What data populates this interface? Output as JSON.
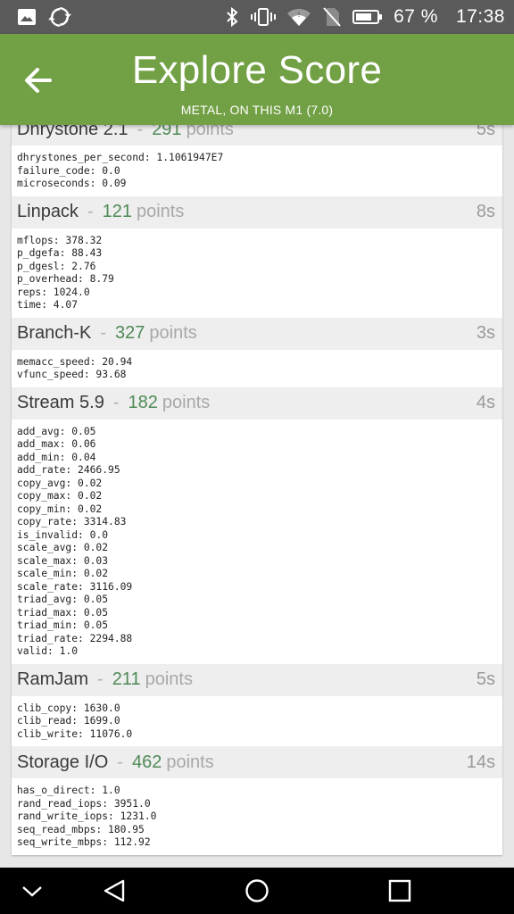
{
  "status_bar": {
    "battery": "67 %",
    "time": "17:38"
  },
  "app_bar": {
    "title": "Explore Score",
    "subtitle": "METAL, ON THIS M1 (7.0)"
  },
  "sections": [
    {
      "name": "Dhrystone 2.1",
      "score": "291",
      "points_label": "points",
      "time": "5s",
      "lines": [
        "dhrystones_per_second: 1.1061947E7",
        "failure_code: 0.0",
        "microseconds: 0.09"
      ]
    },
    {
      "name": "Linpack",
      "score": "121",
      "points_label": "points",
      "time": "8s",
      "lines": [
        "mflops: 378.32",
        "p_dgefa: 88.43",
        "p_dgesl: 2.76",
        "p_overhead: 8.79",
        "reps: 1024.0",
        "time: 4.07"
      ]
    },
    {
      "name": "Branch-K",
      "score": "327",
      "points_label": "points",
      "time": "3s",
      "lines": [
        "memacc_speed: 20.94",
        "vfunc_speed: 93.68"
      ]
    },
    {
      "name": "Stream 5.9",
      "score": "182",
      "points_label": "points",
      "time": "4s",
      "lines": [
        "add_avg: 0.05",
        "add_max: 0.06",
        "add_min: 0.04",
        "add_rate: 2466.95",
        "copy_avg: 0.02",
        "copy_max: 0.02",
        "copy_min: 0.02",
        "copy_rate: 3314.83",
        "is_invalid: 0.0",
        "scale_avg: 0.02",
        "scale_max: 0.03",
        "scale_min: 0.02",
        "scale_rate: 3116.09",
        "triad_avg: 0.05",
        "triad_max: 0.05",
        "triad_min: 0.05",
        "triad_rate: 2294.88",
        "valid: 1.0"
      ]
    },
    {
      "name": "RamJam",
      "score": "211",
      "points_label": "points",
      "time": "5s",
      "lines": [
        "clib_copy: 1630.0",
        "clib_read: 1699.0",
        "clib_write: 11076.0"
      ]
    },
    {
      "name": "Storage I/O",
      "score": "462",
      "points_label": "points",
      "time": "14s",
      "lines": [
        "has_o_direct: 1.0",
        "rand_read_iops: 3951.0",
        "rand_write_iops: 1231.0",
        "seq_read_mbps: 180.95",
        "seq_write_mbps: 112.92"
      ]
    }
  ],
  "colors": {
    "app_bar": "#72a045",
    "score": "#4f8a57",
    "status_bar": "#5a5a5a"
  },
  "icons": [
    "image-icon",
    "sync-icon",
    "bluetooth-icon",
    "vibrate-icon",
    "wifi-icon",
    "no-sim-icon",
    "battery-icon",
    "back-arrow-icon",
    "nav-down-icon",
    "nav-back-icon",
    "nav-home-icon",
    "nav-recents-icon"
  ]
}
